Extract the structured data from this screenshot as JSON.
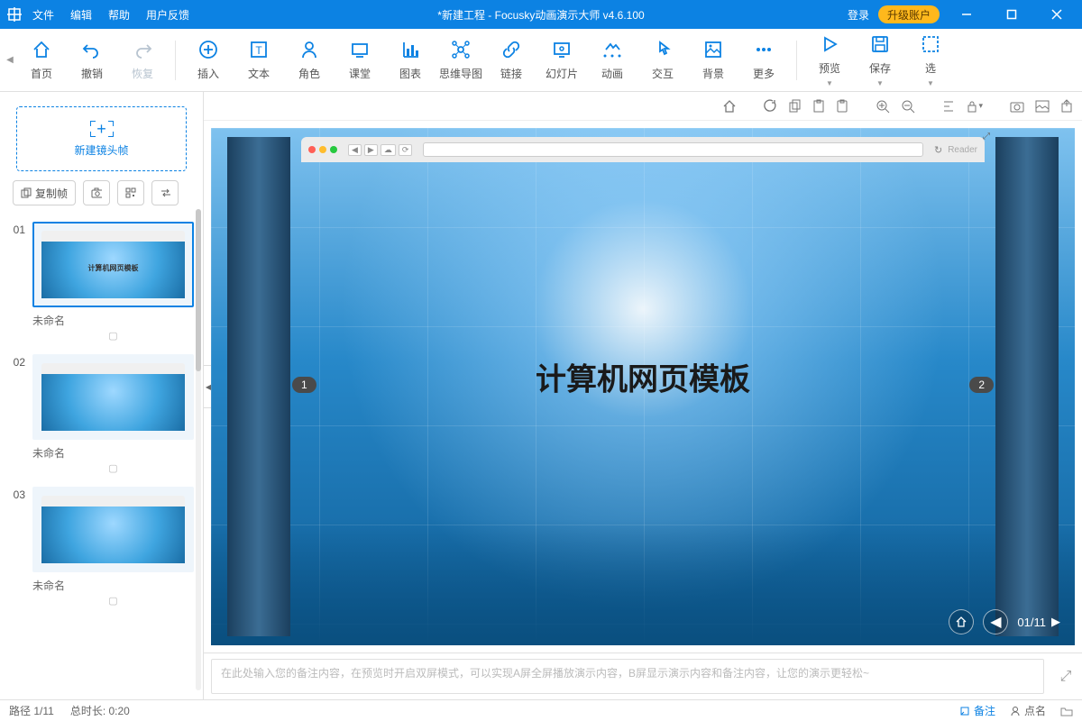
{
  "titlebar": {
    "menus": [
      "文件",
      "编辑",
      "帮助",
      "用户反馈"
    ],
    "title": "*新建工程 - Focusky动画演示大师  v4.6.100",
    "login": "登录",
    "upgrade": "升级账户"
  },
  "toolbar": {
    "items": [
      {
        "label": "首页",
        "icon": "home"
      },
      {
        "label": "撤销",
        "icon": "undo"
      },
      {
        "label": "恢复",
        "icon": "redo",
        "disabled": true
      }
    ],
    "items2": [
      {
        "label": "插入",
        "icon": "insert"
      },
      {
        "label": "文本",
        "icon": "text"
      },
      {
        "label": "角色",
        "icon": "role"
      },
      {
        "label": "课堂",
        "icon": "class"
      },
      {
        "label": "图表",
        "icon": "chart"
      },
      {
        "label": "思维导图",
        "icon": "mindmap"
      },
      {
        "label": "链接",
        "icon": "link"
      },
      {
        "label": "幻灯片",
        "icon": "slide"
      },
      {
        "label": "动画",
        "icon": "anim"
      },
      {
        "label": "交互",
        "icon": "interact"
      },
      {
        "label": "背景",
        "icon": "bg"
      },
      {
        "label": "更多",
        "icon": "more"
      }
    ],
    "items3": [
      {
        "label": "预览",
        "icon": "preview"
      },
      {
        "label": "保存",
        "icon": "save"
      },
      {
        "label": "选",
        "icon": "select"
      }
    ]
  },
  "sidebar": {
    "new_frame": "新建镜头帧",
    "copy_frame": "复制帧",
    "slides": [
      {
        "num": "01",
        "title": "未命名",
        "mini": "计算机网页模板"
      },
      {
        "num": "02",
        "title": "未命名",
        "mini": ""
      },
      {
        "num": "03",
        "title": "未命名",
        "mini": ""
      }
    ]
  },
  "canvas": {
    "headline": "计算机网页模板",
    "reader": "Reader",
    "nav_left": "1",
    "nav_right": "2",
    "page_indicator": "01/11"
  },
  "notes": {
    "placeholder": "在此处输入您的备注内容，在预览时开启双屏模式，可以实现A屏全屏播放演示内容，B屏显示演示内容和备注内容，让您的演示更轻松~"
  },
  "statusbar": {
    "path": "路径 1/11",
    "duration": "总时长: 0:20",
    "notes_link": "备注",
    "attention": "点名"
  }
}
